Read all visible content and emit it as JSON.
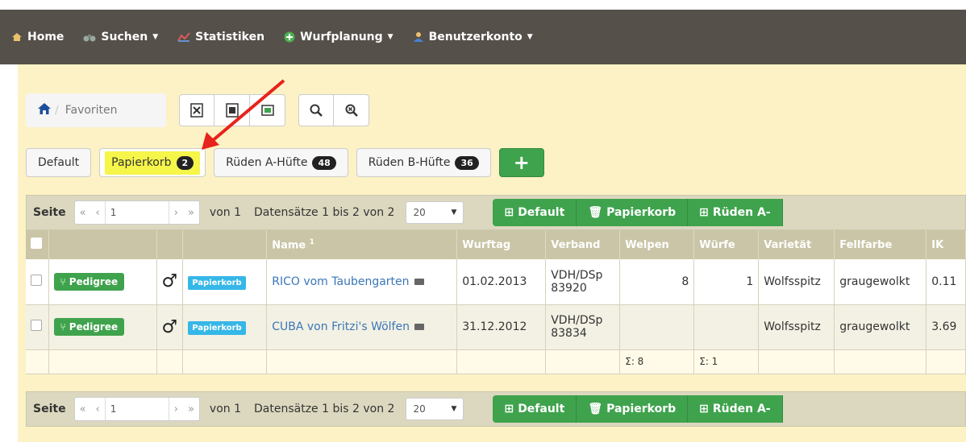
{
  "nav": {
    "home": "Home",
    "suchen": "Suchen",
    "statistiken": "Statistiken",
    "wurfplanung": "Wurfplanung",
    "benutzerkonto": "Benutzerkonto"
  },
  "breadcrumb": {
    "label": "Favoriten"
  },
  "tabs": {
    "default": "Default",
    "papierkorb": "Papierkorb",
    "papierkorb_count": "2",
    "ruden_a": "Rüden A-Hüfte",
    "ruden_a_count": "48",
    "ruden_b": "Rüden B-Hüfte",
    "ruden_b_count": "36"
  },
  "pager": {
    "seite": "Seite",
    "page": "1",
    "von": "von 1",
    "records": "Datensätze 1 bis 2 von 2",
    "per_page": "20",
    "btn_default": "Default",
    "btn_papierkorb": "Papierkorb",
    "btn_ruden": "Rüden A-"
  },
  "table": {
    "headers": {
      "name": "Name",
      "name_sup": "1",
      "wurftag": "Wurftag",
      "verband": "Verband",
      "welpen": "Welpen",
      "wurfe": "Würfe",
      "varietat": "Varietät",
      "fellfarbe": "Fellfarbe",
      "ik": "IK"
    },
    "pedigree_label": "Pedigree",
    "papierkorb_label": "Papierkorb",
    "rows": [
      {
        "name": "RICO vom Taubengarten",
        "wurftag": "01.02.2013",
        "verband_1": "VDH/DSp",
        "verband_2": "83920",
        "welpen": "8",
        "wurfe": "1",
        "varietat": "Wolfsspitz",
        "fellfarbe": "graugewolkt",
        "ik": "0.11"
      },
      {
        "name": "CUBA von Fritzi's Wölfen",
        "wurftag": "31.12.2012",
        "verband_1": "VDH/DSp",
        "verband_2": "83834",
        "welpen": "",
        "wurfe": "",
        "varietat": "Wolfsspitz",
        "fellfarbe": "graugewolkt",
        "ik": "3.69"
      }
    ],
    "sum_welpen": "Σ: 8",
    "sum_wurfe": "Σ: 1"
  },
  "colors": {
    "navbar": "#55504a",
    "panel": "#fcf2c5",
    "green": "#3fa34d",
    "highlight": "#f5f54a",
    "arrow": "#e8231c"
  }
}
